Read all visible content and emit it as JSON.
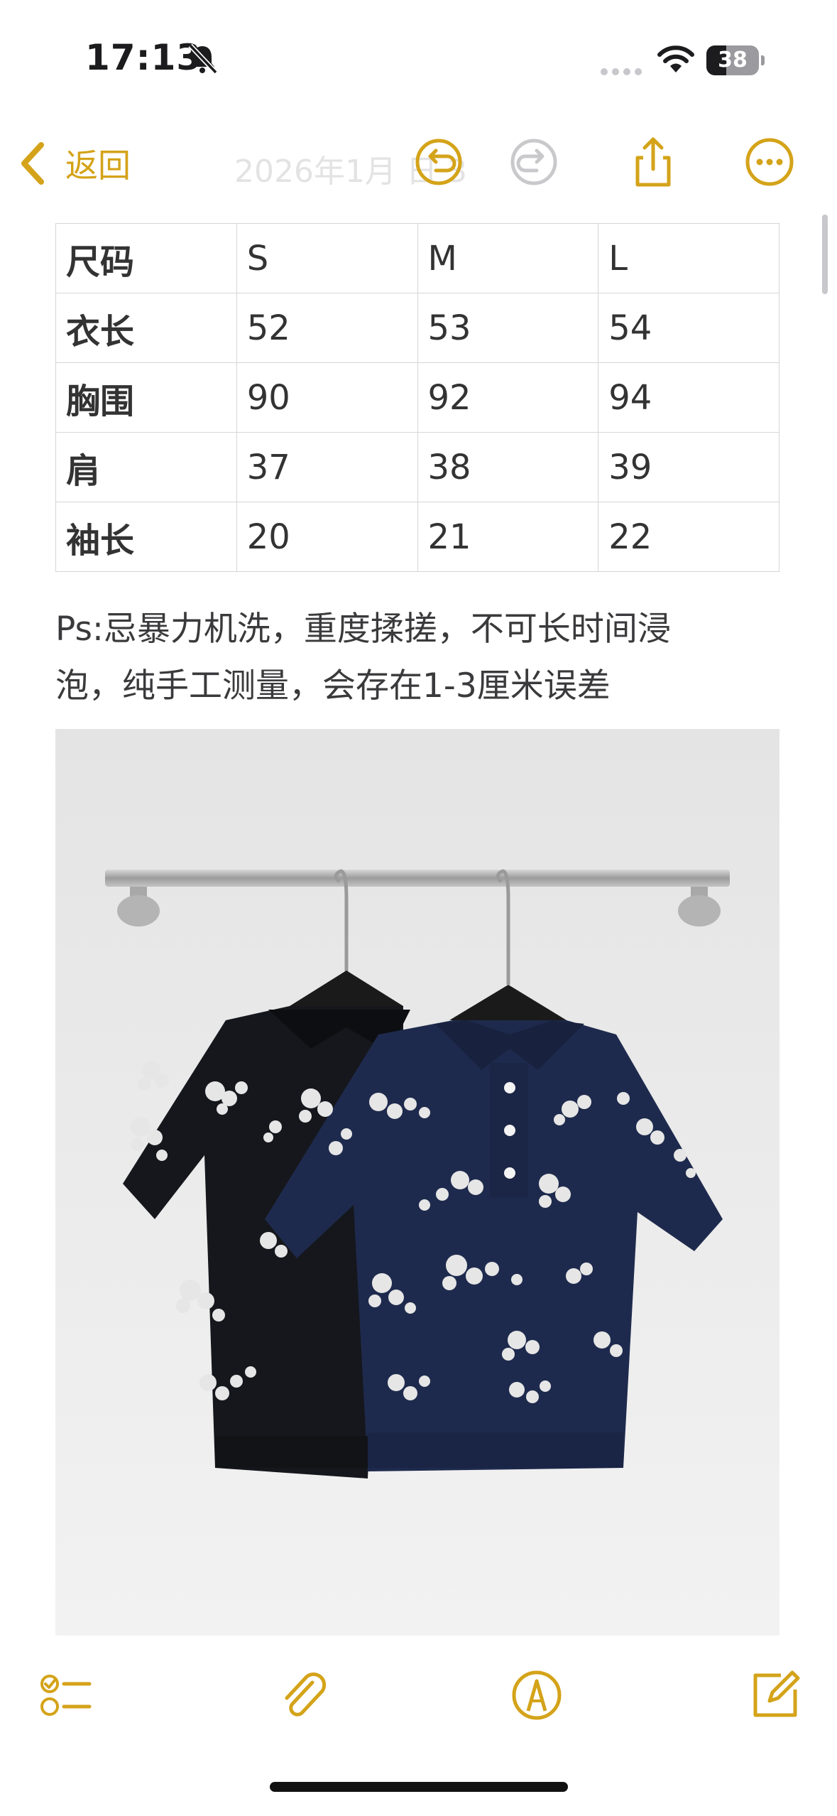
{
  "status_bar": {
    "time": "17:13",
    "battery_level": "38",
    "icons": [
      "bell-slash-icon",
      "cellular-signal-icon",
      "wifi-icon",
      "battery-icon"
    ]
  },
  "nav": {
    "back_label": "返回",
    "title_faded": "2026年1月 日 3",
    "icons": [
      "chevron-left-icon",
      "undo-icon",
      "redo-icon",
      "share-icon",
      "more-icon"
    ],
    "accent_color": "#d4a319"
  },
  "size_table": {
    "rows": [
      [
        "尺码",
        "S",
        "M",
        "L"
      ],
      [
        "衣长",
        "52",
        "53",
        "54"
      ],
      [
        "胸围",
        "90",
        "92",
        "94"
      ],
      [
        "肩",
        "37",
        "38",
        "39"
      ],
      [
        "袖长",
        "20",
        "21",
        "22"
      ]
    ]
  },
  "note": {
    "line1": "Ps:忌暴力机洗，重度揉搓，不可长时间浸",
    "line2": "泡，纯手工测量，会存在1-3厘米误差"
  },
  "photo": {
    "subject": "product-photo",
    "colors": {
      "wall": "#ececec",
      "black_top": "#15171c",
      "navy_top": "#1e2a4d",
      "flower": "#e6e6e6",
      "rail": "#b8b8b8"
    }
  },
  "toolbar": {
    "icons": [
      "checklist-icon",
      "paperclip-icon",
      "markup-icon",
      "compose-icon"
    ]
  }
}
